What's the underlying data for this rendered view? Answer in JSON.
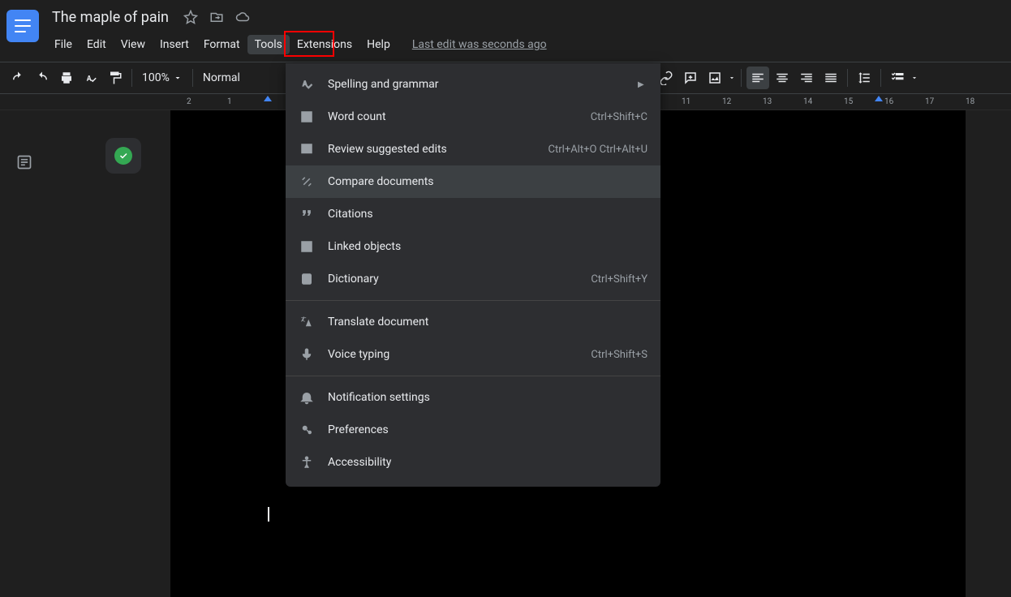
{
  "header": {
    "doc_title": "The maple of pain",
    "edit_info": "Last edit was seconds ago",
    "menus": {
      "file": "File",
      "edit": "Edit",
      "view": "View",
      "insert": "Insert",
      "format": "Format",
      "tools": "Tools",
      "extensions": "Extensions",
      "help": "Help"
    }
  },
  "toolbar": {
    "zoom": "100%",
    "style": "Normal"
  },
  "ruler": {
    "marks_left": [
      "2",
      "1"
    ],
    "marks_right": [
      "11",
      "12",
      "13",
      "14",
      "15",
      "16",
      "17",
      "18"
    ]
  },
  "tools_menu": {
    "items": [
      {
        "label": "Spelling and grammar",
        "shortcut": "",
        "submenu": true
      },
      {
        "label": "Word count",
        "shortcut": "Ctrl+Shift+C"
      },
      {
        "label": "Review suggested edits",
        "shortcut": "Ctrl+Alt+O Ctrl+Alt+U"
      },
      {
        "label": "Compare documents",
        "shortcut": ""
      },
      {
        "label": "Citations",
        "shortcut": ""
      },
      {
        "label": "Linked objects",
        "shortcut": ""
      },
      {
        "label": "Dictionary",
        "shortcut": "Ctrl+Shift+Y"
      },
      {
        "label": "Translate document",
        "shortcut": ""
      },
      {
        "label": "Voice typing",
        "shortcut": "Ctrl+Shift+S"
      },
      {
        "label": "Notification settings",
        "shortcut": ""
      },
      {
        "label": "Preferences",
        "shortcut": ""
      },
      {
        "label": "Accessibility",
        "shortcut": ""
      }
    ]
  }
}
